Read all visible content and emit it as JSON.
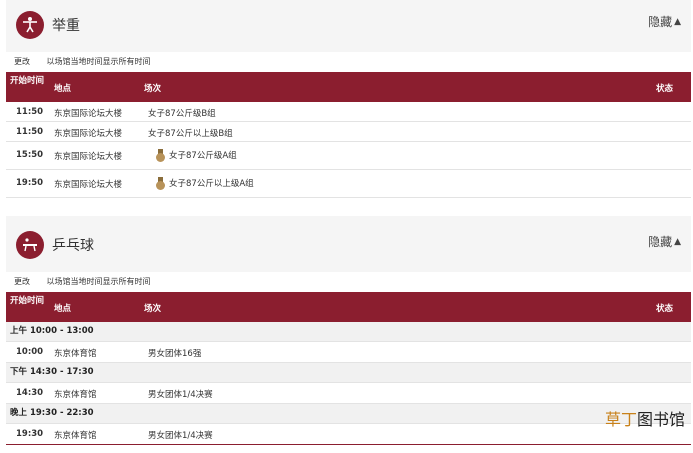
{
  "weightlifting": {
    "title": "举重",
    "hide_label": "隐藏",
    "change_label": "更改",
    "timezone_note": "以场馆当地时间显示所有时间",
    "headers": {
      "time": "开始时间",
      "venue": "地点",
      "event": "场次",
      "status": "状态"
    },
    "rows": [
      {
        "time": "11:50",
        "venue": "东京国际论坛大楼",
        "event": "女子87公斤级B组",
        "medal": false
      },
      {
        "time": "11:50",
        "venue": "东京国际论坛大楼",
        "event": "女子87公斤以上级B组",
        "medal": false
      },
      {
        "time": "15:50",
        "venue": "东京国际论坛大楼",
        "event": "女子87公斤级A组",
        "medal": true
      },
      {
        "time": "19:50",
        "venue": "东京国际论坛大楼",
        "event": "女子87公斤以上级A组",
        "medal": true
      }
    ]
  },
  "table_tennis": {
    "title": "乒乓球",
    "hide_label": "隐藏",
    "change_label": "更改",
    "timezone_note": "以场馆当地时间显示所有时间",
    "headers": {
      "time": "开始时间",
      "venue": "地点",
      "event": "场次",
      "status": "状态"
    },
    "groups": [
      {
        "label": "上午 10:00 - 13:00",
        "row": {
          "time": "10:00",
          "venue": "东京体育馆",
          "event": "男女团体16强"
        }
      },
      {
        "label": "下午 14:30 - 17:30",
        "row": {
          "time": "14:30",
          "venue": "东京体育馆",
          "event": "男女团体1/4决赛"
        }
      },
      {
        "label": "晚上 19:30 - 22:30",
        "row": {
          "time": "19:30",
          "venue": "东京体育馆",
          "event": "男女团体1/4决赛"
        }
      }
    ]
  },
  "watermark": {
    "accent": "草丁",
    "rest": "图书馆"
  },
  "colors": {
    "brand": "#8b1e2f",
    "medal": "#b8935a"
  }
}
